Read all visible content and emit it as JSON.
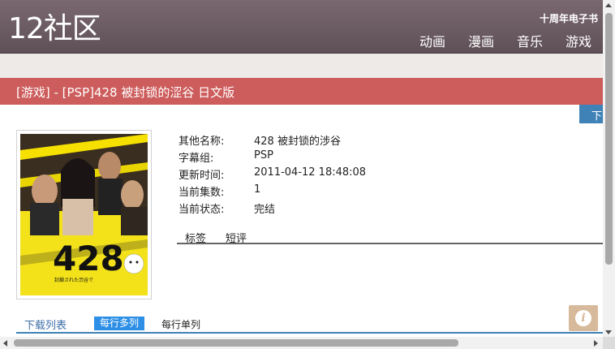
{
  "site": {
    "logo": "12社区",
    "top_link": "十周年电子书",
    "nav": [
      "动画",
      "漫画",
      "音乐",
      "游戏"
    ]
  },
  "title": "[游戏] - [PSP]428 被封锁的涩谷 日文版",
  "download_button": "下",
  "cover": {
    "title_text": "428",
    "alt": "428 cover art"
  },
  "info": [
    {
      "label": "其他名称:",
      "value": "428 被封锁的涉谷"
    },
    {
      "label": "字幕组:",
      "value": "PSP"
    },
    {
      "label": "更新时间:",
      "value": "2011-04-12 18:48:08"
    },
    {
      "label": "当前集数:",
      "value": "1"
    },
    {
      "label": "当前状态:",
      "value": "完结"
    }
  ],
  "tabs": [
    "标签",
    "短评"
  ],
  "download_list": {
    "label": "下载列表",
    "multi": "每行多列",
    "single": "每行单列"
  },
  "colors": {
    "header": "#6b5a62",
    "title_bar": "#cd5c5c",
    "accent_blue": "#2e8fe6",
    "info_button": "#d7b99b"
  },
  "icons": {
    "info": "info-icon"
  }
}
